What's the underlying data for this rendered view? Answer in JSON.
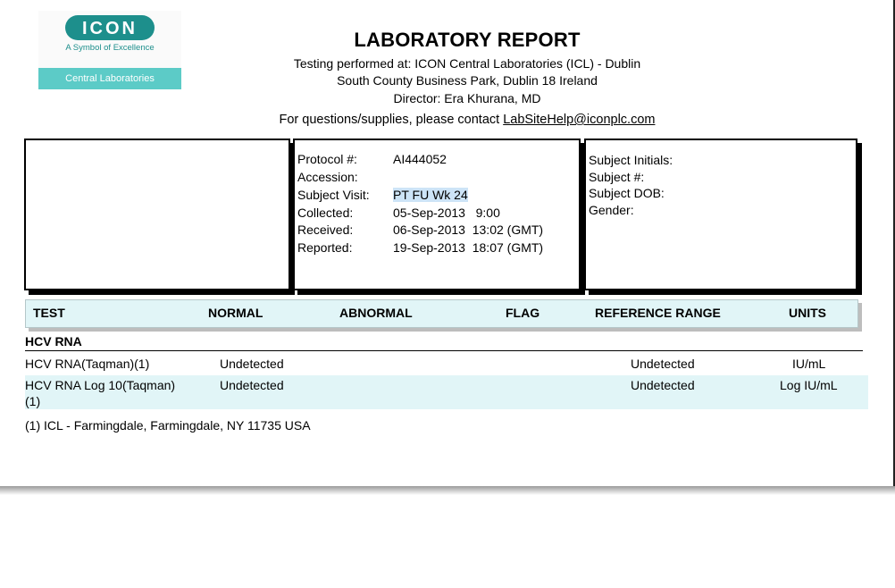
{
  "logo": {
    "brand": "ICON",
    "tagline": "A Symbol of Excellence",
    "division": "Central Laboratories",
    "colors": {
      "teal": "#1d8f8c",
      "band": "#5ccbc7"
    }
  },
  "header": {
    "title": "LABORATORY REPORT",
    "lines": [
      "Testing performed at: ICON Central Laboratories (ICL) - Dublin",
      "South County Business Park, Dublin 18 Ireland",
      "Director: Era Khurana, MD"
    ],
    "contact_prefix": "For questions/supplies, please contact ",
    "contact_email": "LabSiteHelp@iconplc.com"
  },
  "protocol_box": {
    "rows": [
      {
        "label": "Protocol #:",
        "value": "AI444052"
      },
      {
        "label": "Accession:",
        "value": ""
      },
      {
        "label": "Subject Visit:",
        "value": "PT FU Wk 24"
      },
      {
        "label": "Collected:",
        "value": "05-Sep-2013   9:00"
      },
      {
        "label": "Received:",
        "value": "06-Sep-2013  13:02 (GMT)"
      },
      {
        "label": "Reported:",
        "value": "19-Sep-2013  18:07 (GMT)"
      }
    ]
  },
  "subject_box": {
    "labels": [
      "Subject Initials:",
      "Subject #:",
      "Subject DOB:",
      "Gender:"
    ]
  },
  "table": {
    "headers": [
      "TEST",
      "NORMAL",
      "ABNORMAL",
      "FLAG",
      "REFERENCE RANGE",
      "UNITS"
    ],
    "section": "HCV RNA",
    "rows": [
      {
        "test": "HCV RNA(Taqman)(1)",
        "test2": "",
        "normal": "Undetected",
        "range": "Undetected",
        "units": "IU/mL"
      },
      {
        "test": "HCV RNA Log 10(Taqman)",
        "test2": "(1)",
        "normal": "Undetected",
        "range": "Undetected",
        "units": "Log IU/mL"
      }
    ]
  },
  "footnote": "(1) ICL - Farmingdale, Farmingdale, NY 11735 USA"
}
